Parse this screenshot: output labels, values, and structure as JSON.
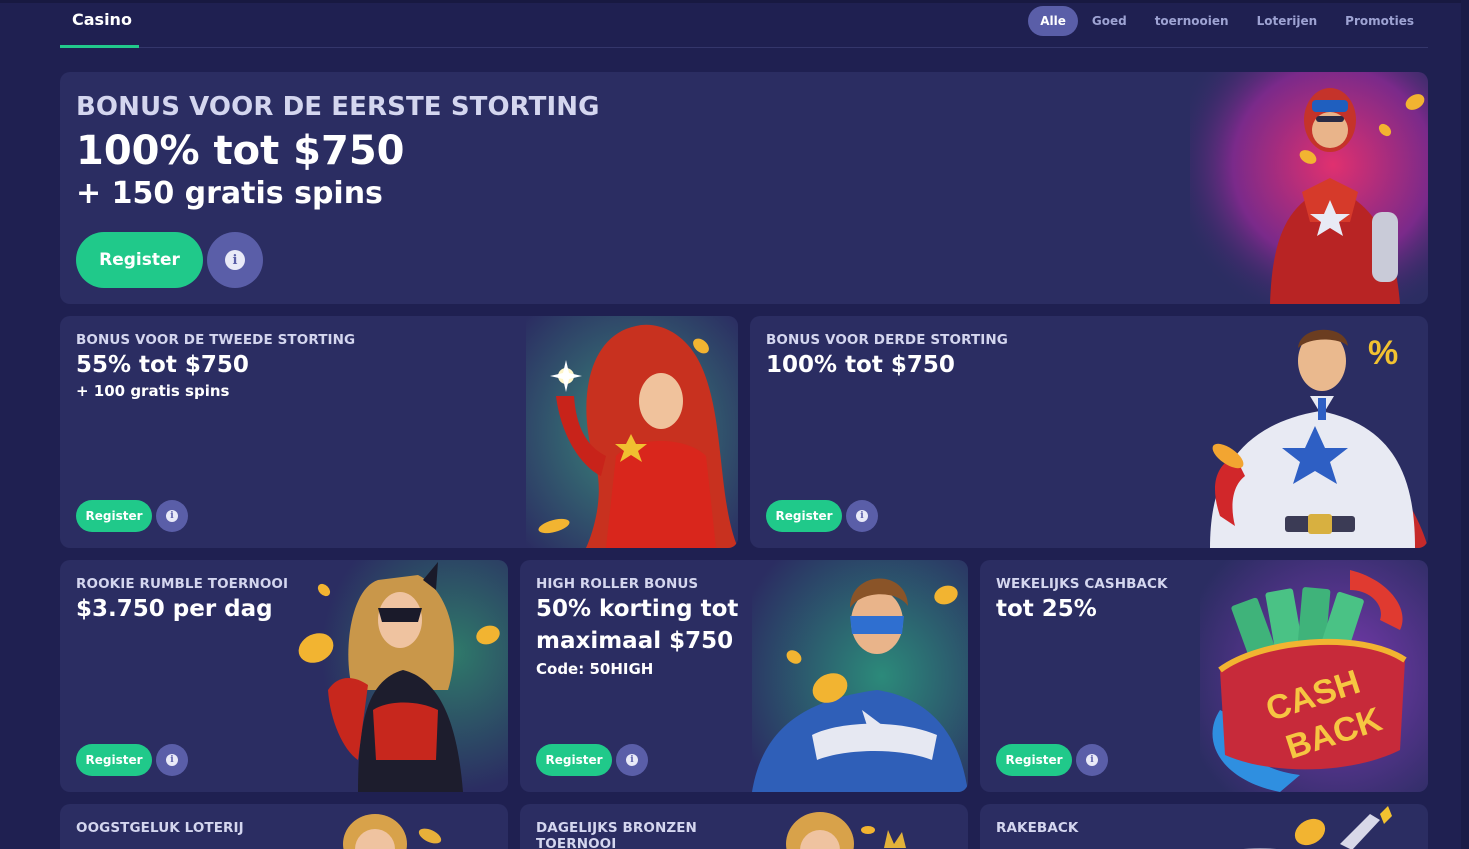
{
  "header": {
    "brand": "Casino",
    "filters": [
      {
        "label": "Alle",
        "active": true
      },
      {
        "label": "Goed",
        "active": false
      },
      {
        "label": "toernooien",
        "active": false
      },
      {
        "label": "Loterijen",
        "active": false
      },
      {
        "label": "Promoties",
        "active": false
      }
    ]
  },
  "hero": {
    "category": "BONUS VOOR DE EERSTE STORTING",
    "title": "100% tot $750",
    "subtitle": "+ 150 gratis spins",
    "register_label": "Register",
    "info_icon": "info-icon"
  },
  "cards": {
    "second_deposit": {
      "category": "BONUS VOOR DE TWEEDE STORTING",
      "title": "55% tot $750",
      "subtitle": "+ 100 gratis spins",
      "register_label": "Register"
    },
    "third_deposit": {
      "category": "BONUS VOOR DERDE STORTING",
      "title": "100% tot $750",
      "register_label": "Register"
    },
    "rookie": {
      "category": "ROOKIE RUMBLE TOERNOOI",
      "title": "$3.750 per dag",
      "register_label": "Register"
    },
    "high_roller": {
      "category": "HIGH ROLLER BONUS",
      "title_line1": "50% korting tot",
      "title_line2": "maximaal $750",
      "code": "Code: 50HIGH",
      "register_label": "Register"
    },
    "cashback": {
      "category": "WEKELIJKS CASHBACK",
      "title": "tot 25%",
      "register_label": "Register",
      "art_text_1": "CASH",
      "art_text_2": "BACK"
    },
    "harvest": {
      "category": "OOGSTGELUK LOTERIJ"
    },
    "bronze": {
      "category_line1": "DAGELIJKS BRONZEN",
      "category_line2": "TOERNOOI"
    },
    "rakeback": {
      "category": "RAKEBACK"
    }
  },
  "art": {
    "percent_badge": "%"
  },
  "colors": {
    "background": "#1f2051",
    "card": "#2b2d62",
    "accent_green": "#20c98a",
    "info_button": "#5a5ea8"
  }
}
